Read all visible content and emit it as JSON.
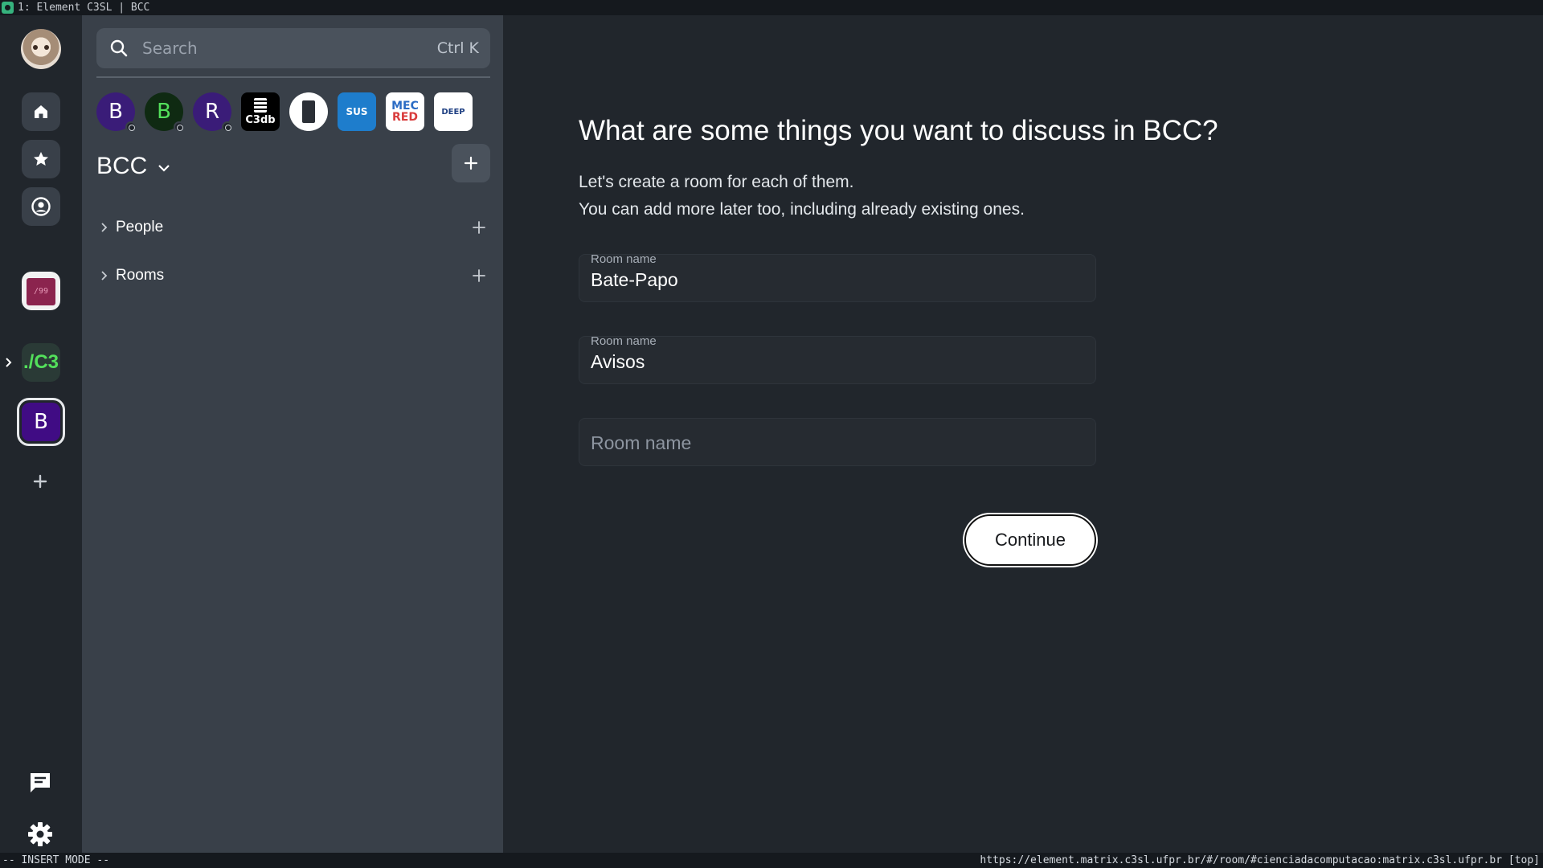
{
  "window": {
    "title": "1: Element C3SL | BCC"
  },
  "statusbar": {
    "mode": "-- INSERT MODE --",
    "url": "https://element.matrix.c3sl.ufpr.br/#/room/#cienciadacomputacao:matrix.c3sl.ufpr.br [top]"
  },
  "rail": {
    "items": [
      {
        "name": "user-avatar",
        "icon": "user-avatar"
      },
      {
        "name": "home",
        "icon": "home-icon"
      },
      {
        "name": "favourites",
        "icon": "star-icon"
      },
      {
        "name": "people",
        "icon": "person-circle-icon"
      },
      {
        "name": "space-1",
        "label": "/99"
      },
      {
        "name": "space-c3",
        "label": "./C3"
      },
      {
        "name": "space-bcc",
        "label": "B"
      },
      {
        "name": "create-space",
        "icon": "plus-icon"
      },
      {
        "name": "threads",
        "icon": "threads-icon"
      },
      {
        "name": "settings",
        "icon": "gear-icon"
      }
    ],
    "space1_label": "/99",
    "space_c3_label": "./C3",
    "space_bcc_label": "B"
  },
  "roomlist": {
    "search": {
      "placeholder": "Search",
      "shortcut": "Ctrl K"
    },
    "subspaces": [
      {
        "label": "B",
        "color": "#3a1c78",
        "badge": true
      },
      {
        "label": "B",
        "color": "#0f2a12",
        "text_color": "#53e05b",
        "badge": true
      },
      {
        "label": "R",
        "color": "#3a1c78",
        "badge": true
      },
      {
        "label": "C3db",
        "color": "#000000"
      },
      {
        "label": "",
        "color": "#ffffff"
      },
      {
        "label": "SUS",
        "color": "#1e7dcc"
      },
      {
        "label_top": "MEC",
        "label_bottom": "RED",
        "color": "#ffffff"
      },
      {
        "label": "DEEP",
        "color": "#ffffff"
      }
    ],
    "space_name": "BCC",
    "sections": [
      {
        "label": "People"
      },
      {
        "label": "Rooms"
      }
    ]
  },
  "main": {
    "heading": "What are some things you want to discuss in BCC?",
    "desc_line1": "Let's create a room for each of them.",
    "desc_line2": "You can add more later too, including already existing ones.",
    "fields": [
      {
        "label": "Room name",
        "value": "Bate-Papo"
      },
      {
        "label": "Room name",
        "value": "Avisos"
      },
      {
        "label": "",
        "value": "",
        "placeholder": "Room name"
      }
    ],
    "continue_label": "Continue"
  },
  "colors": {
    "background": "#21262c",
    "panel": "#394049",
    "space_bcc": "#400c84"
  }
}
